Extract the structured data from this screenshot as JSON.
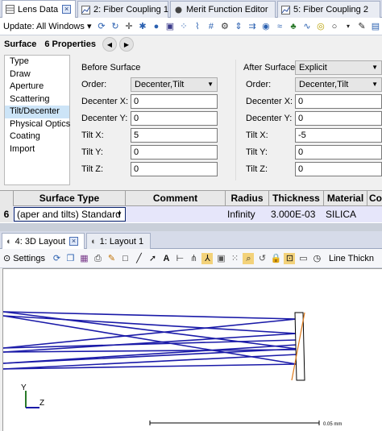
{
  "tabs": [
    {
      "label": "Lens Data",
      "active": true,
      "closable": true
    },
    {
      "label": "2: Fiber Coupling 1",
      "active": false
    },
    {
      "label": "Merit Function Editor",
      "active": false
    },
    {
      "label": "5: Fiber Coupling 2",
      "active": false
    }
  ],
  "toolbar": {
    "update_label": "Update: All Windows",
    "icons": [
      "refresh-icon",
      "circle-arrows-icon",
      "crosshair-icon",
      "settings-icon",
      "globe-icon",
      "image-icon",
      "scatter-icon",
      "lens-icon",
      "grid-icon",
      "gear-icon",
      "split-icon",
      "rays-icon",
      "sphere-icon",
      "wave-icon",
      "leaf-icon",
      "wave-diff-icon",
      "stop-icon",
      "circle-icon",
      "dropdown-icon",
      "edit-icon",
      "chart-icon",
      "undo-icon",
      "link-icon",
      "arrow-right-icon"
    ]
  },
  "surface_header": {
    "label": "Surface",
    "properties": "6 Properties",
    "prev": "◀",
    "next": "▶"
  },
  "categories": [
    "Type",
    "Draw",
    "Aperture",
    "Scattering",
    "Tilt/Decenter",
    "Physical Optics",
    "Coating",
    "Import"
  ],
  "selected_category": "Tilt/Decenter",
  "before": {
    "title": "Before Surface",
    "order_label": "Order:",
    "order_value": "Decenter,Tilt",
    "fields": [
      {
        "label": "Decenter X:",
        "value": "0"
      },
      {
        "label": "Decenter Y:",
        "value": "0"
      },
      {
        "label": "Tilt X:",
        "value": "5"
      },
      {
        "label": "Tilt Y:",
        "value": "0"
      },
      {
        "label": "Tilt Z:",
        "value": "0"
      }
    ]
  },
  "after": {
    "title": "After Surface:",
    "mode_value": "Explicit",
    "order_label": "Order:",
    "order_value": "Decenter,Tilt",
    "fields": [
      {
        "label": "Decenter X:",
        "value": "0"
      },
      {
        "label": "Decenter Y:",
        "value": "0"
      },
      {
        "label": "Tilt X:",
        "value": "-5"
      },
      {
        "label": "Tilt Y:",
        "value": "0"
      },
      {
        "label": "Tilt Z:",
        "value": "0"
      }
    ]
  },
  "grid": {
    "headers": [
      "Surface Type",
      "Comment",
      "Radius",
      "Thickness",
      "Material",
      "Co"
    ],
    "row": {
      "number": "6",
      "surface_type": "(aper and tilts) Standard",
      "comment": "",
      "radius": "Infinity",
      "thickness": "3.000E-03",
      "material": "SILICA"
    }
  },
  "bottom_tabs": [
    {
      "label": "4: 3D Layout",
      "active": true,
      "closable": true
    },
    {
      "label": "1: Layout 1",
      "active": false
    }
  ],
  "layout_toolbar": {
    "settings_label": "Settings",
    "line_thickness_label": "Line Thickn"
  },
  "plot": {
    "axis_y": "Y",
    "axis_z": "Z",
    "scale_label": "0.05 mm",
    "ray_color": "#1a1aa8",
    "surface_color": "#e07a1a"
  }
}
